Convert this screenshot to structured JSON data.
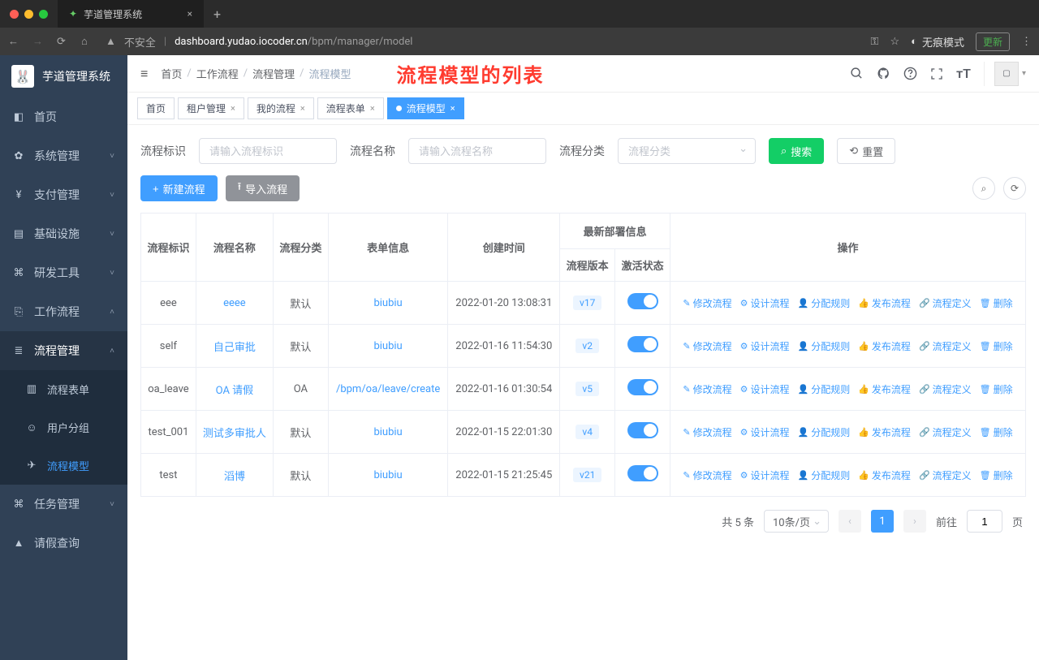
{
  "browser": {
    "tab_title": "芋道管理系统",
    "insecure_label": "不安全",
    "url_host": "dashboard.yudao.iocoder.cn",
    "url_path": "/bpm/manager/model",
    "incognito": "无痕模式",
    "update_btn": "更新"
  },
  "brand": {
    "name": "芋道管理系统"
  },
  "sidebar": {
    "items": [
      {
        "icon": "◧",
        "label": "首页"
      },
      {
        "icon": "✿",
        "label": "系统管理",
        "chev": true
      },
      {
        "icon": "¥",
        "label": "支付管理",
        "chev": true
      },
      {
        "icon": "▤",
        "label": "基础设施",
        "chev": true
      },
      {
        "icon": "⌘",
        "label": "研发工具",
        "chev": true
      },
      {
        "icon": "⎘",
        "label": "工作流程",
        "chev_up": true
      }
    ],
    "workflow_sub": {
      "title": "流程管理",
      "items": [
        {
          "icon": "▥",
          "label": "流程表单"
        },
        {
          "icon": "☺",
          "label": "用户分组"
        },
        {
          "icon": "✈",
          "label": "流程模型",
          "active": true
        }
      ]
    },
    "tail": [
      {
        "icon": "⌘",
        "label": "任务管理",
        "chev": true
      },
      {
        "icon": "▲",
        "label": "请假查询"
      }
    ]
  },
  "breadcrumb": {
    "items": [
      "首页",
      "工作流程",
      "流程管理",
      "流程模型"
    ]
  },
  "annotation": "流程模型的列表",
  "tags": [
    {
      "label": "首页"
    },
    {
      "label": "租户管理",
      "closable": true
    },
    {
      "label": "我的流程",
      "closable": true
    },
    {
      "label": "流程表单",
      "closable": true
    },
    {
      "label": "流程模型",
      "closable": true,
      "active": true
    }
  ],
  "filters": {
    "key_label": "流程标识",
    "key_placeholder": "请输入流程标识",
    "name_label": "流程名称",
    "name_placeholder": "请输入流程名称",
    "cat_label": "流程分类",
    "cat_placeholder": "流程分类",
    "search_btn": "搜索",
    "reset_btn": "重置"
  },
  "toolbar": {
    "new_btn": "新建流程",
    "import_btn": "导入流程"
  },
  "table": {
    "headers": {
      "key": "流程标识",
      "name": "流程名称",
      "cat": "流程分类",
      "form": "表单信息",
      "created": "创建时间",
      "deploy": "最新部署信息",
      "version": "流程版本",
      "status": "激活状态",
      "ops": "操作"
    },
    "ops_labels": {
      "edit": "修改流程",
      "design": "设计流程",
      "assign": "分配规则",
      "publish": "发布流程",
      "def": "流程定义",
      "delete": "删除"
    },
    "rows": [
      {
        "key": "eee",
        "name": "eeee",
        "cat": "默认",
        "form": "biubiu",
        "created": "2022-01-20 13:08:31",
        "version": "v17",
        "active": true
      },
      {
        "key": "self",
        "name": "自己审批",
        "cat": "默认",
        "form": "biubiu",
        "created": "2022-01-16 11:54:30",
        "version": "v2",
        "active": true
      },
      {
        "key": "oa_leave",
        "name": "OA 请假",
        "cat": "OA",
        "form": "/bpm/oa/leave/create",
        "created": "2022-01-16 01:30:54",
        "version": "v5",
        "active": true
      },
      {
        "key": "test_001",
        "name": "测试多审批人",
        "cat": "默认",
        "form": "biubiu",
        "created": "2022-01-15 22:01:30",
        "version": "v4",
        "active": true
      },
      {
        "key": "test",
        "name": "滔博",
        "cat": "默认",
        "form": "biubiu",
        "created": "2022-01-15 21:25:45",
        "version": "v21",
        "active": true
      }
    ]
  },
  "pagination": {
    "total": "共 5 条",
    "per_page": "10条/页",
    "current": "1",
    "goto_prefix": "前往",
    "goto_value": "1",
    "goto_suffix": "页"
  }
}
